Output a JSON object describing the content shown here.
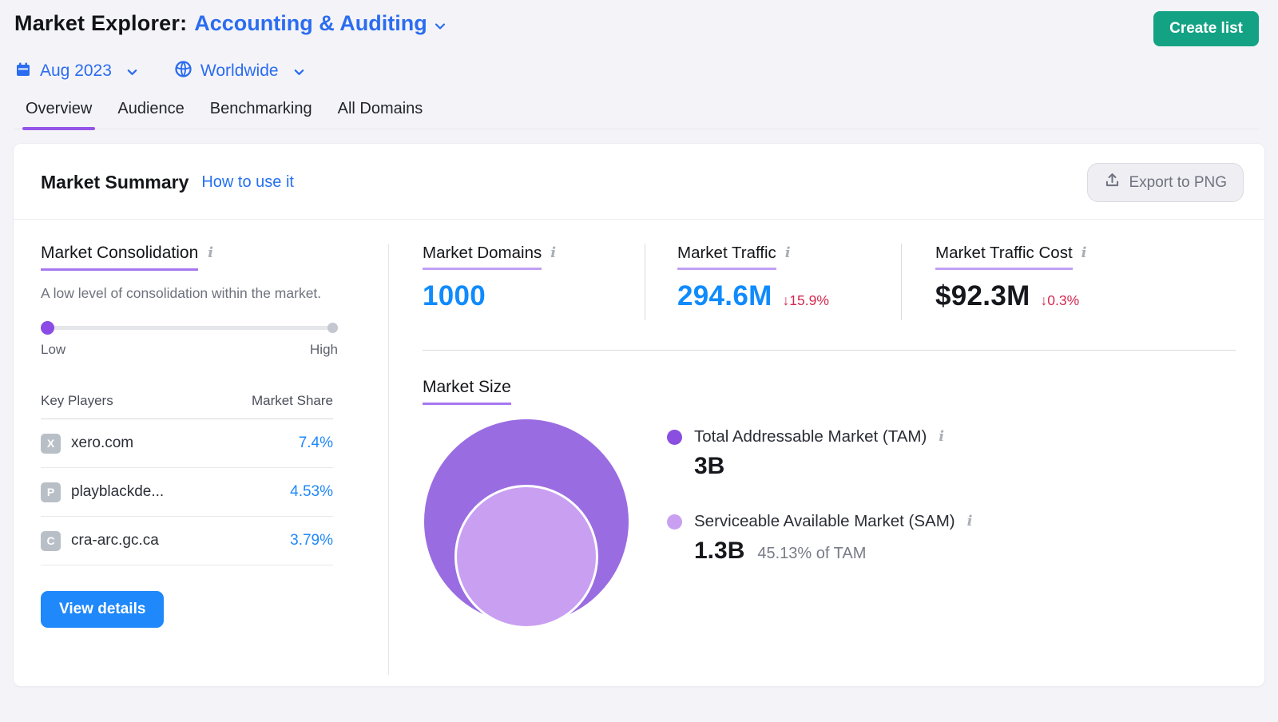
{
  "colors": {
    "accent_purple": "#9455e8",
    "underline_purple": "#a678ef",
    "stat_blue": "#108bfd",
    "link_blue": "#2b6cf0",
    "negative_red": "#d52950",
    "green_button": "#13a384",
    "view_details_blue": "#1f88fa",
    "tam_bubble": "#9a6ce1",
    "sam_bubble": "#c99ff2"
  },
  "header": {
    "title_prefix": "Market Explorer:",
    "market_name": "Accounting & Auditing",
    "create_list_label": "Create list",
    "date_label": "Aug 2023",
    "region_label": "Worldwide"
  },
  "tabs": {
    "items": [
      {
        "label": "Overview",
        "active": true
      },
      {
        "label": "Audience",
        "active": false
      },
      {
        "label": "Benchmarking",
        "active": false
      },
      {
        "label": "All Domains",
        "active": false
      }
    ]
  },
  "summary": {
    "title": "Market Summary",
    "how_to_link": "How to use it",
    "export_label": "Export to PNG"
  },
  "consolidation": {
    "title": "Market Consolidation",
    "description": "A low level of consolidation within the market.",
    "slider_low": "Low",
    "slider_high": "High",
    "slider_value": "low",
    "table": {
      "col_players": "Key Players",
      "col_share": "Market Share",
      "rows": [
        {
          "initial": "X",
          "domain": "xero.com",
          "share": "7.4%"
        },
        {
          "initial": "P",
          "domain": "playblackde...",
          "share": "4.53%"
        },
        {
          "initial": "C",
          "domain": "cra-arc.gc.ca",
          "share": "3.79%"
        }
      ]
    },
    "view_details_label": "View details"
  },
  "stats": {
    "items": [
      {
        "label": "Market Domains",
        "value": "1000",
        "change": ""
      },
      {
        "label": "Market Traffic",
        "value": "294.6M",
        "change": "↓15.9%"
      },
      {
        "label": "Market Traffic Cost",
        "value": "$92.3M",
        "change": "↓0.3%"
      }
    ]
  },
  "market_size": {
    "title": "Market Size",
    "tam": {
      "label": "Total Addressable Market (TAM)",
      "value": "3B"
    },
    "sam": {
      "label": "Serviceable Available Market (SAM)",
      "value": "1.3B",
      "note": "45.13% of TAM"
    }
  },
  "chart_data": {
    "type": "bubble",
    "title": "Market Size",
    "series": [
      {
        "name": "Total Addressable Market (TAM)",
        "value": 3000000000,
        "display": "3B",
        "color": "#9a6ce1"
      },
      {
        "name": "Serviceable Available Market (SAM)",
        "value": 1300000000,
        "display": "1.3B",
        "percent_of_tam": 45.13,
        "color": "#c99ff2"
      }
    ],
    "legend_position": "right"
  }
}
